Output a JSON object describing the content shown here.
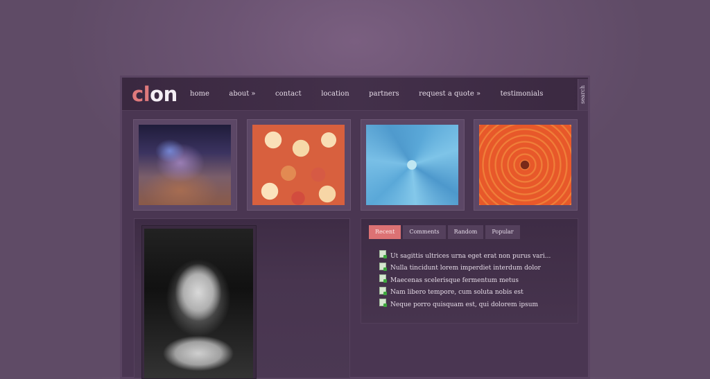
{
  "logo": {
    "part1": "cl",
    "part2": "on"
  },
  "nav": {
    "items": [
      {
        "label": "home"
      },
      {
        "label": "about »"
      },
      {
        "label": "contact"
      },
      {
        "label": "location"
      },
      {
        "label": "partners"
      },
      {
        "label": "request a quote »"
      },
      {
        "label": "testimonials"
      }
    ],
    "search_label": "search"
  },
  "gallery": {
    "items": [
      {
        "name": "butterfly-photo",
        "icon": "butterfly-on-lavender"
      },
      {
        "name": "roses-photo",
        "icon": "roses-bouquet"
      },
      {
        "name": "succulent-photo",
        "icon": "blue-succulent"
      },
      {
        "name": "dahlia-photo",
        "icon": "orange-dahlia"
      }
    ]
  },
  "feature": {
    "image": "portrait-photo"
  },
  "widget": {
    "tabs": [
      {
        "label": "Recent",
        "active": true
      },
      {
        "label": "Comments",
        "active": false
      },
      {
        "label": "Random",
        "active": false
      },
      {
        "label": "Popular",
        "active": false
      }
    ],
    "posts": [
      {
        "title": "Ut sagittis ultrices urna eget erat non purus vari..."
      },
      {
        "title": "Nulla tincidunt lorem imperdiet interdum dolor"
      },
      {
        "title": "Maecenas scelerisque fermentum metus"
      },
      {
        "title": "Nam libero tempore, cum soluta nobis est"
      },
      {
        "title": "Neque porro quisquam est, qui dolorem ipsum"
      }
    ]
  },
  "colors": {
    "accent": "#dc7274",
    "background": "#5f4b66",
    "page": "#4a3652",
    "header": "#3a2840"
  }
}
